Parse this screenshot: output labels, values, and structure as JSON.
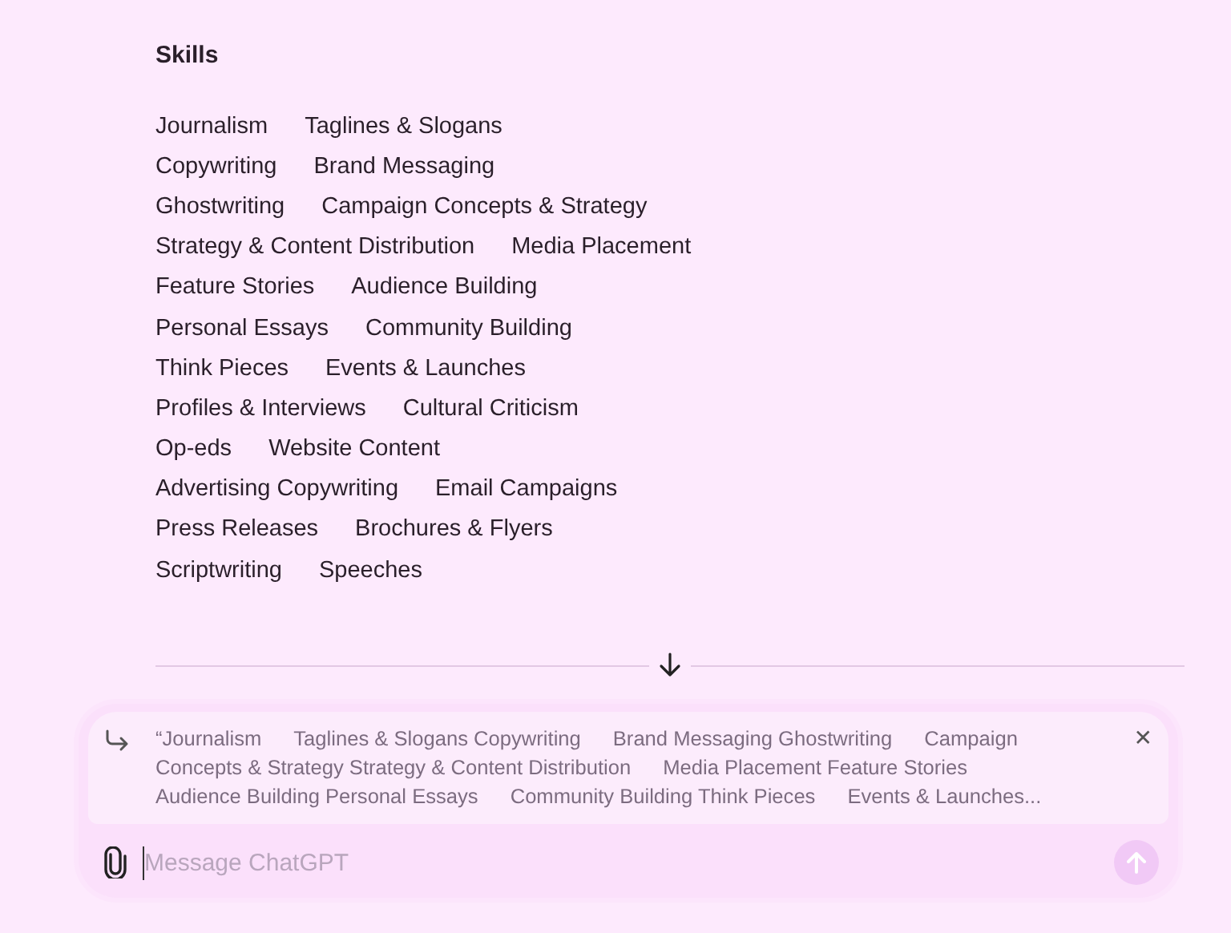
{
  "section": {
    "heading": "Skills",
    "rows": [
      [
        "Journalism",
        "Taglines & Slogans"
      ],
      [
        "Copywriting",
        "Brand Messaging"
      ],
      [
        "Ghostwriting",
        "Campaign Concepts & Strategy"
      ],
      [
        "Strategy & Content Distribution",
        "Media Placement"
      ],
      [
        "Feature Stories",
        "Audience Building"
      ],
      [
        "Personal Essays",
        "Community Building"
      ],
      [
        "Think Pieces",
        "Events & Launches"
      ],
      [
        "Profiles & Interviews",
        "Cultural Criticism"
      ],
      [
        "Op-eds",
        "Website Content"
      ],
      [
        "Advertising Copywriting",
        "Email Campaigns"
      ],
      [
        "Press Releases",
        "Brochures & Flyers"
      ],
      [
        "Scriptwriting",
        "Speeches"
      ]
    ]
  },
  "composer": {
    "quote_lines": [
      [
        "“Journalism",
        "Taglines & Slogans Copywriting",
        "Brand Messaging Ghostwriting",
        "Campaign"
      ],
      [
        "Concepts & Strategy Strategy & Content Distribution",
        "Media Placement Feature Stories"
      ],
      [
        "Audience Building Personal Essays",
        "Community Building Think Pieces",
        "Events & Launches..."
      ]
    ],
    "close_glyph": "✕",
    "placeholder": "Message ChatGPT",
    "send_disabled": true
  }
}
